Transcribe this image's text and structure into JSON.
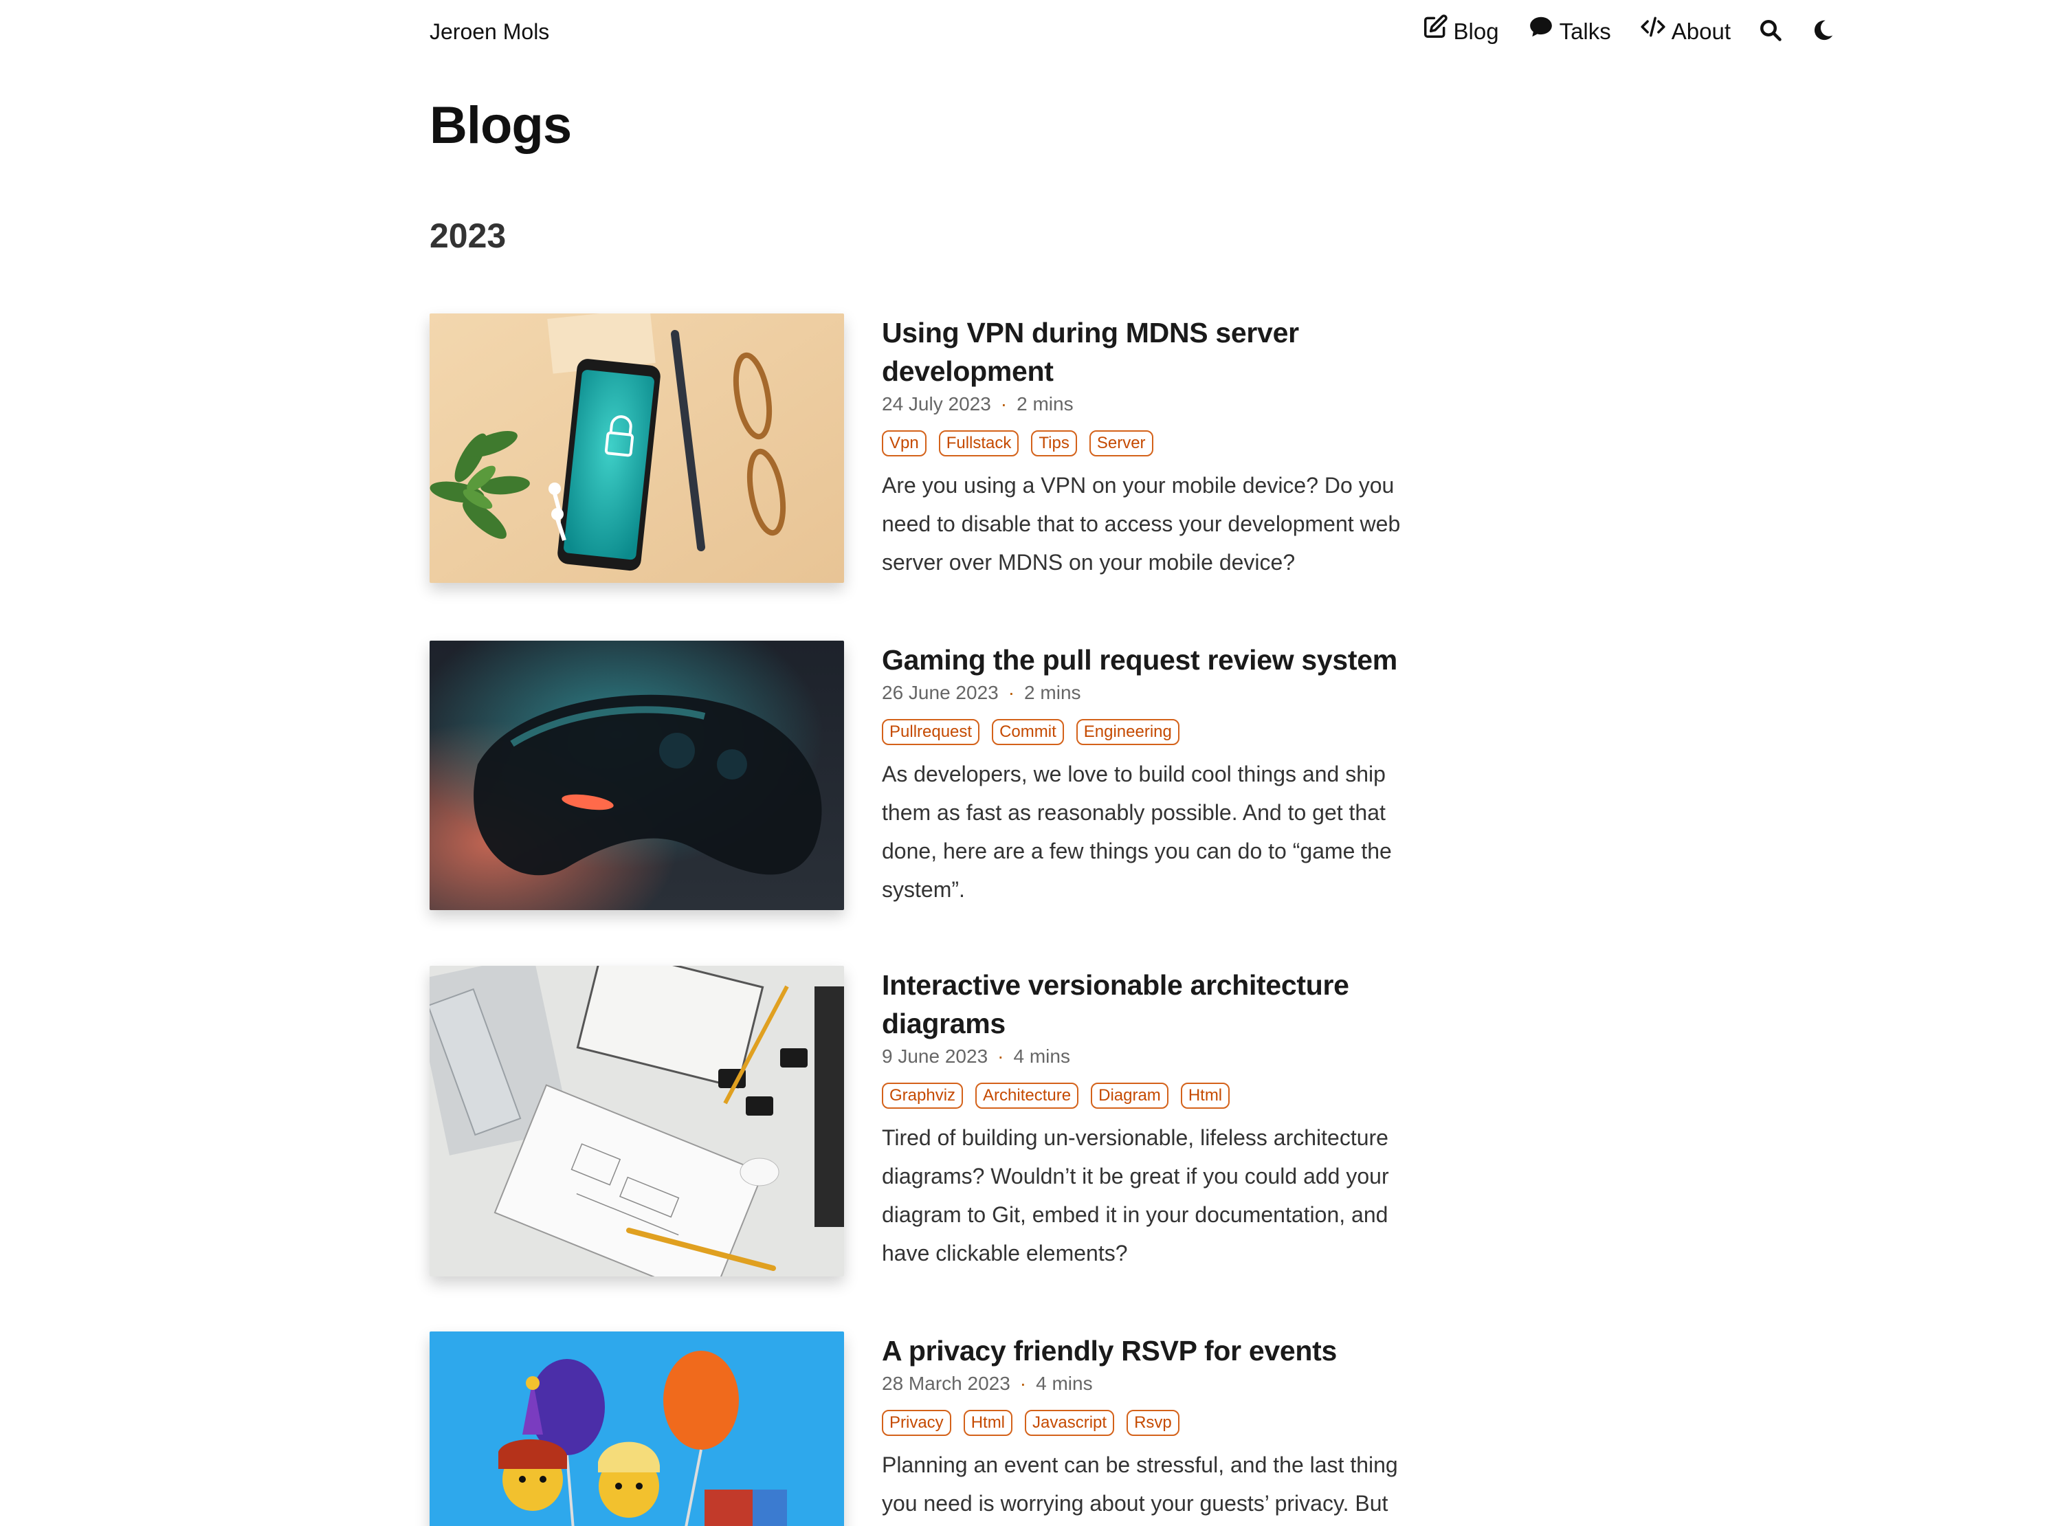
{
  "header": {
    "site_title": "Jeroen Mols",
    "nav": [
      {
        "label": "Blog",
        "icon": "edit-icon"
      },
      {
        "label": "Talks",
        "icon": "speech-bubble-icon"
      },
      {
        "label": "About",
        "icon": "code-icon"
      }
    ],
    "search_icon": "search-icon",
    "theme_icon": "moon-icon"
  },
  "page": {
    "title": "Blogs",
    "year": "2023"
  },
  "posts": [
    {
      "title": "Using VPN during MDNS server development",
      "date": "24 July 2023",
      "separator": "·",
      "duration": "2 mins",
      "tags": [
        "Vpn",
        "Fullstack",
        "Tips",
        "Server"
      ],
      "excerpt": "Are you using a VPN on your mobile device? Do you need to disable that to access your development web server over MDNS on your mobile device?",
      "image": "phone-with-vpn-lock-photo"
    },
    {
      "title": "Gaming the pull request review system",
      "date": "26 June 2023",
      "separator": "·",
      "duration": "2 mins",
      "tags": [
        "Pullrequest",
        "Commit",
        "Engineering"
      ],
      "excerpt": "As developers, we love to build cool things and ship them as fast as reasonably possible. And to get that done, here are a few things you can do to “game the system”.",
      "image": "game-controller-photo"
    },
    {
      "title": "Interactive versionable architecture diagrams",
      "date": "9 June 2023",
      "separator": "·",
      "duration": "4 mins",
      "tags": [
        "Graphviz",
        "Architecture",
        "Diagram",
        "Html"
      ],
      "excerpt": "Tired of building un-versionable, lifeless architecture diagrams? Wouldn’t it be great if you could add your diagram to Git, embed it in your documentation, and have clickable elements?",
      "image": "desk-with-sketches-photo"
    },
    {
      "title": "A privacy friendly RSVP for events",
      "date": "28 March 2023",
      "separator": "·",
      "duration": "4 mins",
      "tags": [
        "Privacy",
        "Html",
        "Javascript",
        "Rsvp"
      ],
      "excerpt": "Planning an event can be stressful, and the last thing you need is worrying about your guests’ privacy. But don’t worry, I’ve got you covered with a privacy-friendly",
      "image": "lego-figures-balloons-photo"
    }
  ]
}
